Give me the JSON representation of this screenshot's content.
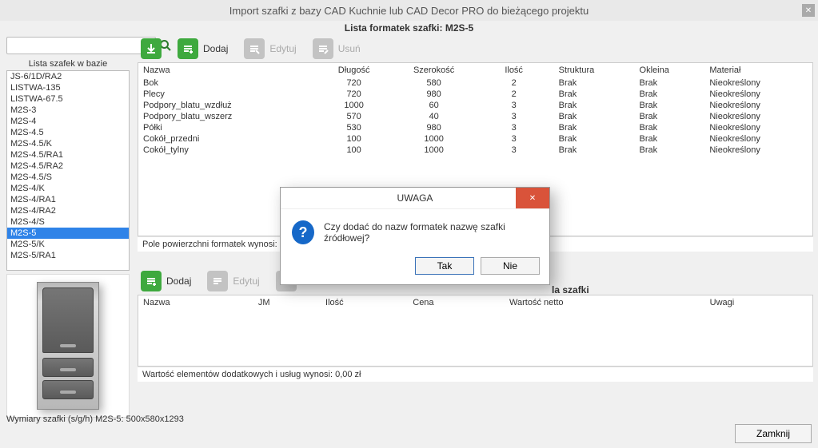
{
  "window": {
    "title": "Import szafki z bazy CAD Kuchnie lub CAD Decor PRO do bieżącego projektu"
  },
  "subheader": "Lista formatek szafki: M2S-5",
  "search": {
    "placeholder": ""
  },
  "left": {
    "title": "Lista szafek w bazie",
    "items": [
      "JS-6/1D/RA2",
      "LISTWA-135",
      "LISTWA-67.5",
      "M2S-3",
      "M2S-4",
      "M2S-4.5",
      "M2S-4.5/K",
      "M2S-4.5/RA1",
      "M2S-4.5/RA2",
      "M2S-4.5/S",
      "M2S-4/K",
      "M2S-4/RA1",
      "M2S-4/RA2",
      "M2S-4/S",
      "M2S-5",
      "M2S-5/K",
      "M2S-5/RA1"
    ],
    "selected_index": 14
  },
  "toolbar_top": {
    "download": "",
    "add": "Dodaj",
    "edit": "Edytuj",
    "remove": "Usuń"
  },
  "table1": {
    "headers": [
      "Nazwa",
      "Długość",
      "Szerokość",
      "Ilość",
      "Struktura",
      "Okleina",
      "Materiał"
    ],
    "rows": [
      {
        "Nazwa": "Bok",
        "Długość": "720",
        "Szerokość": "580",
        "Ilość": "2",
        "Struktura": "Brak",
        "Okleina": "Brak",
        "Materiał": "Nieokreślony"
      },
      {
        "Nazwa": "Plecy",
        "Długość": "720",
        "Szerokość": "980",
        "Ilość": "2",
        "Struktura": "Brak",
        "Okleina": "Brak",
        "Materiał": "Nieokreślony"
      },
      {
        "Nazwa": "Podpory_blatu_wzdłuż",
        "Długość": "1000",
        "Szerokość": "60",
        "Ilość": "3",
        "Struktura": "Brak",
        "Okleina": "Brak",
        "Materiał": "Nieokreślony"
      },
      {
        "Nazwa": "Podpory_blatu_wszerz",
        "Długość": "570",
        "Szerokość": "40",
        "Ilość": "3",
        "Struktura": "Brak",
        "Okleina": "Brak",
        "Materiał": "Nieokreślony"
      },
      {
        "Nazwa": "Półki",
        "Długość": "530",
        "Szerokość": "980",
        "Ilość": "3",
        "Struktura": "Brak",
        "Okleina": "Brak",
        "Materiał": "Nieokreślony"
      },
      {
        "Nazwa": "Cokół_przedni",
        "Długość": "100",
        "Szerokość": "1000",
        "Ilość": "3",
        "Struktura": "Brak",
        "Okleina": "Brak",
        "Materiał": "Nieokreślony"
      },
      {
        "Nazwa": "Cokół_tylny",
        "Długość": "100",
        "Szerokość": "1000",
        "Ilość": "3",
        "Struktura": "Brak",
        "Okleina": "Brak",
        "Materiał": "Nieokreślony"
      }
    ],
    "status": "Pole powierzchni formatek wynosi: 4,653 m"
  },
  "section2_title": "la szafki",
  "toolbar_bottom": {
    "add": "Dodaj",
    "edit": "Edytuj",
    "remove": "Usuń"
  },
  "table2": {
    "headers": [
      "Nazwa",
      "JM",
      "Ilość",
      "Cena",
      "Wartość netto",
      "Uwagi"
    ],
    "status": "Wartość elementów dodatkowych i usług wynosi: 0,00 zł"
  },
  "footer": "Wymiary szafki (s/g/h) M2S-5: 500x580x1293",
  "close_btn": "Zamknij",
  "modal": {
    "title": "UWAGA",
    "message": "Czy dodać do nazw formatek nazwę szafki źródłowej?",
    "yes": "Tak",
    "no": "Nie"
  }
}
